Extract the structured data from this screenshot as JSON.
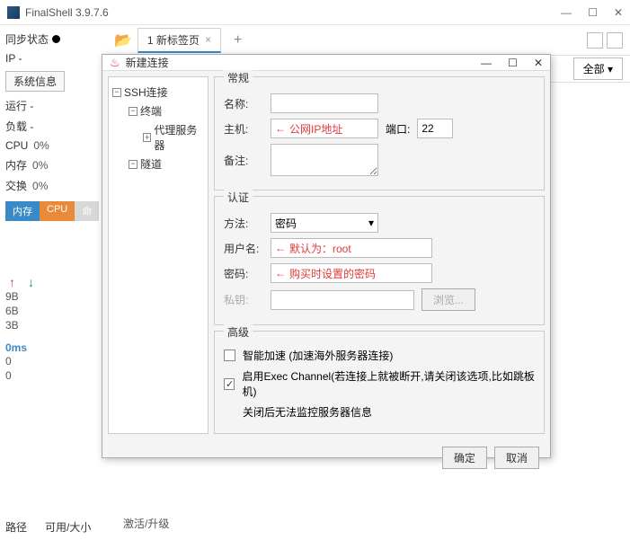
{
  "app": {
    "title": "FinalShell 3.9.7.6"
  },
  "sidebar": {
    "sync": "同步状态",
    "ip": "IP -",
    "sysinfo": "系统信息",
    "run": "运行 -",
    "load": "负载 -",
    "cpu": "CPU",
    "cpu_pct": "0%",
    "mem": "内存",
    "mem_pct": "0%",
    "swap": "交换",
    "swap_pct": "0%",
    "box_mem": "内存",
    "box_cpu": "CPU",
    "box_cmd": "命",
    "s1": "9B",
    "s2": "6B",
    "s3": "3B",
    "latency": "0ms",
    "z1": "0",
    "z2": "0",
    "path_label": "路径",
    "size_label": "可用/大小",
    "activate": "激活/升级"
  },
  "tabs": {
    "tab1": "1 新标签页",
    "new": "+"
  },
  "toolbar": {
    "all": "全部"
  },
  "dialog": {
    "title": "新建连接",
    "tree": {
      "root": "SSH连接",
      "n1": "终端",
      "n2": "代理服务器",
      "n3": "隧道"
    },
    "general": {
      "legend": "常规",
      "name": "名称:",
      "host": "主机:",
      "host_note": "公网IP地址",
      "port": "端口:",
      "port_val": "22",
      "remark": "备注:"
    },
    "auth": {
      "legend": "认证",
      "method": "方法:",
      "method_val": "密码",
      "user": "用户名:",
      "user_note": "默认为：root",
      "pwd": "密码:",
      "pwd_note": "购买时设置的密码",
      "key": "私钥:",
      "browse": "浏览..."
    },
    "adv": {
      "legend": "高级",
      "smart": "智能加速 (加速海外服务器连接)",
      "exec1": "启用Exec Channel(若连接上就被断开,请关闭该选项,比如跳板机)",
      "exec2": "关闭后无法监控服务器信息"
    },
    "ok": "确定",
    "cancel": "取消"
  }
}
